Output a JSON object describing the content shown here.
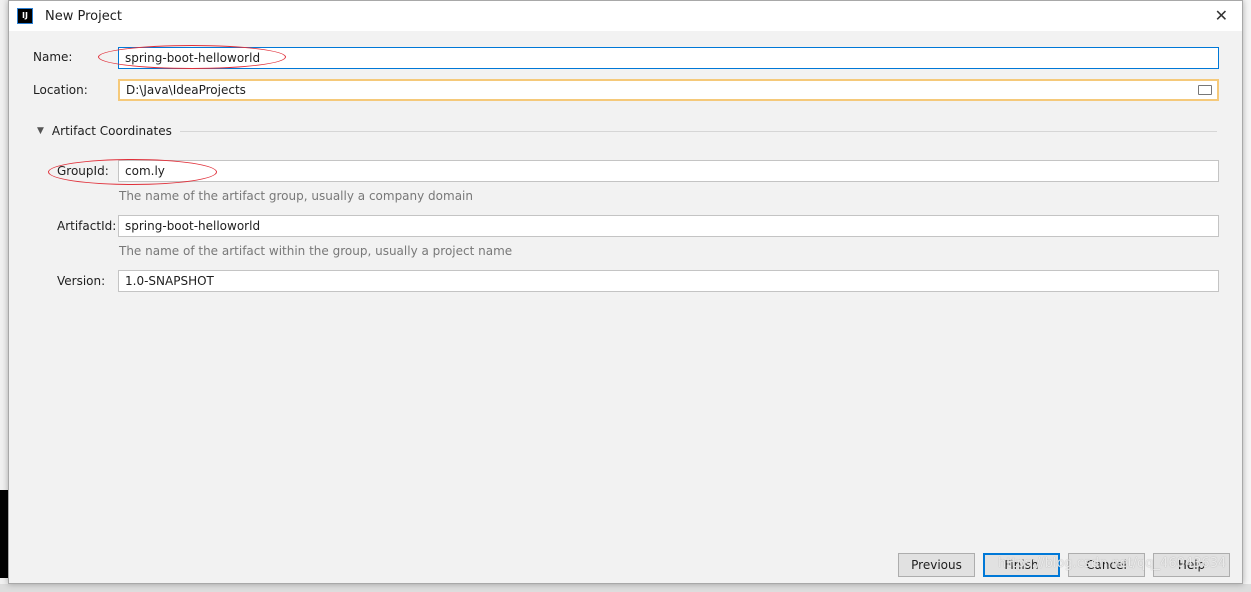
{
  "window": {
    "title": "New Project",
    "logo_text": "IJ"
  },
  "form": {
    "name": {
      "label": "Name:",
      "value": "spring-boot-helloworld"
    },
    "location": {
      "label": "Location:",
      "value": "D:\\Java\\IdeaProjects"
    },
    "section": {
      "title": "Artifact Coordinates"
    },
    "group_id": {
      "label": "GroupId:",
      "value": "com.ly",
      "hint": "The name of the artifact group, usually a company domain"
    },
    "artifact_id": {
      "label": "ArtifactId:",
      "value": "spring-boot-helloworld",
      "hint": "The name of the artifact within the group, usually a project name"
    },
    "version": {
      "label": "Version:",
      "value": "1.0-SNAPSHOT"
    }
  },
  "buttons": {
    "previous": "Previous",
    "finish": "Finish",
    "cancel": "Cancel",
    "help": "Help"
  },
  "watermark": "https://blog.csdn.net/qq_46043634",
  "colors": {
    "accent": "#0078d7",
    "annotation": "#e0303a",
    "location_border": "#f5c97a"
  }
}
